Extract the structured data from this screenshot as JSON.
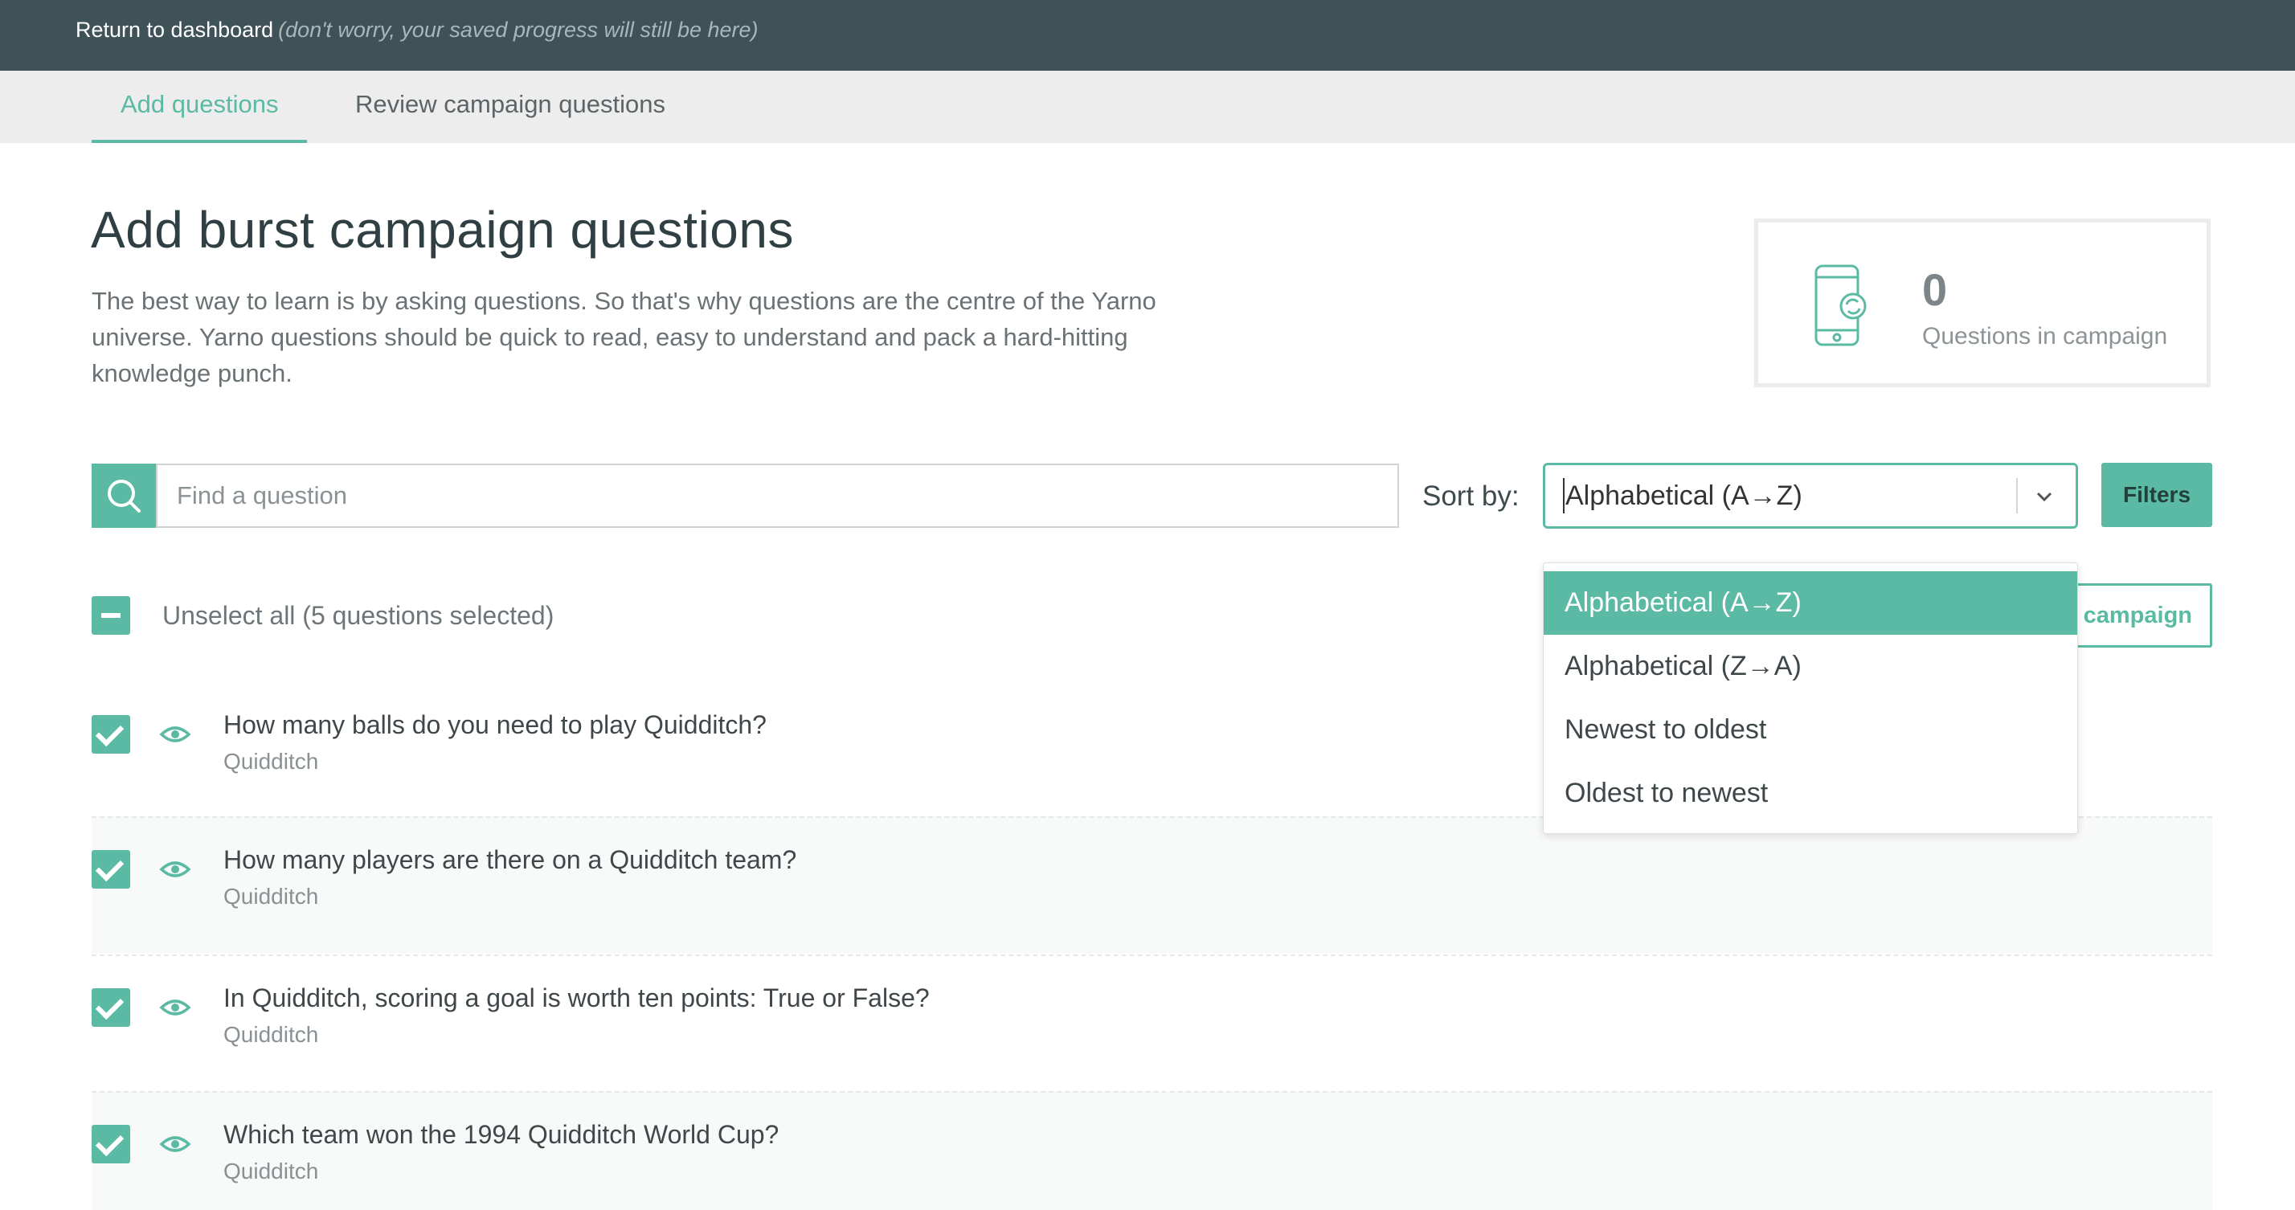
{
  "topbar": {
    "return_label": "Return to dashboard",
    "note": "(don't worry, your saved progress will still be here)"
  },
  "tabs": [
    {
      "label": "Add questions",
      "active": true
    },
    {
      "label": "Review campaign questions",
      "active": false
    }
  ],
  "page": {
    "title": "Add burst campaign questions",
    "intro": "The best way to learn is by asking questions. So that's why questions are the centre of the Yarno universe. Yarno questions should be quick to read, easy to understand and pack a hard-hitting knowledge punch."
  },
  "stats": {
    "count": "0",
    "label": "Questions in campaign",
    "icon": "phone-sync-icon"
  },
  "search": {
    "placeholder": "Find a question",
    "value": "",
    "icon": "search-icon"
  },
  "sort": {
    "label": "Sort by:",
    "value": "Alphabetical (A→Z)",
    "options": [
      "Alphabetical (A→Z)",
      "Alphabetical (Z→A)",
      "Newest to oldest",
      "Oldest to newest"
    ],
    "selected_index": 0
  },
  "filters": {
    "label": "Filters"
  },
  "selection": {
    "unselect_label": "Unselect all (5 questions selected)"
  },
  "add_campaign": {
    "label_visible": "campaign"
  },
  "questions": [
    {
      "text": "How many balls do you need to play Quidditch?",
      "tag": "Quidditch",
      "checked": true
    },
    {
      "text": "How many players are there on a Quidditch team?",
      "tag": "Quidditch",
      "checked": true
    },
    {
      "text": "In Quidditch, scoring a goal is worth ten points: True or False?",
      "tag": "Quidditch",
      "checked": true
    },
    {
      "text": "Which team won the 1994 Quidditch World Cup?",
      "tag": "Quidditch",
      "checked": true
    }
  ],
  "colors": {
    "accent": "#5bbaa3",
    "topbar": "#3f5257",
    "heading": "#2f3f44"
  }
}
